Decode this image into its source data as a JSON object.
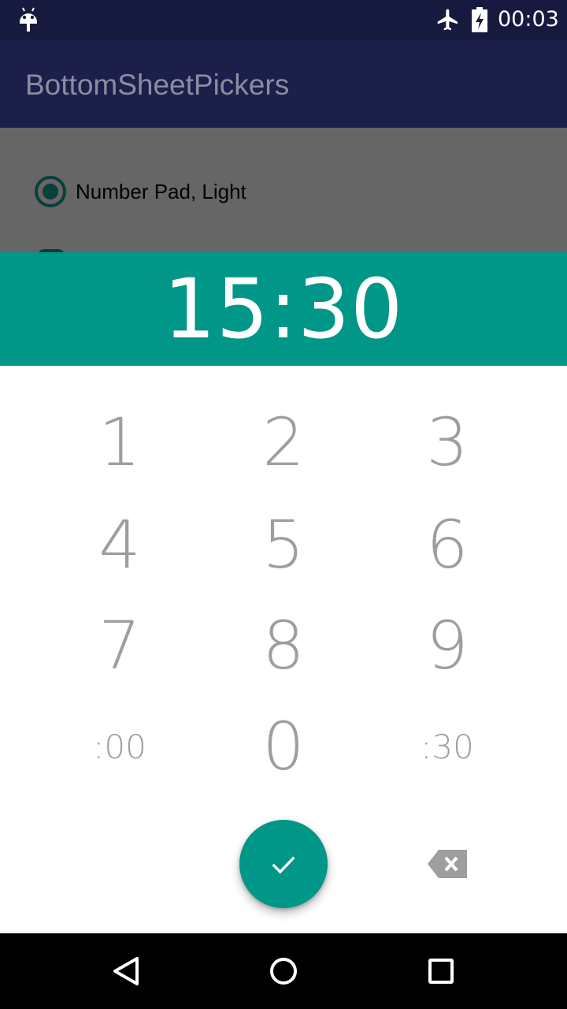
{
  "status_bar": {
    "time": "00:03",
    "icons": [
      "android-icon",
      "airplane-mode-icon",
      "battery-charging-icon"
    ]
  },
  "app_bar": {
    "title": "BottomSheetPickers"
  },
  "background": {
    "radio_option_label": "Number Pad, Light",
    "radio_selected": true
  },
  "picker": {
    "time": "15:30",
    "keys": {
      "k1": "1",
      "k2": "2",
      "k3": "3",
      "k4": "4",
      "k5": "5",
      "k6": "6",
      "k7": "7",
      "k8": "8",
      "k9": "9",
      "alt_left": ":00",
      "k0": "0",
      "alt_right": ":30"
    },
    "confirm_icon": "check-icon",
    "delete_icon": "backspace-icon"
  },
  "nav_bar": {
    "icons": [
      "back-icon",
      "home-icon",
      "recents-icon"
    ]
  },
  "colors": {
    "accent": "#009688",
    "status_bar": "#161a3e",
    "app_bar": "#1b1f4a",
    "key_text": "#9e9e9e"
  }
}
